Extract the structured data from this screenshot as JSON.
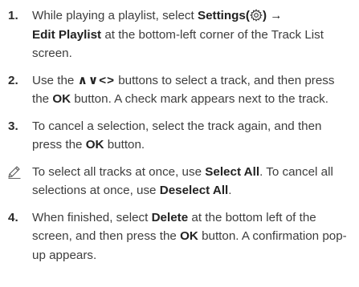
{
  "steps": [
    {
      "num": "1.",
      "parts": {
        "t1": "While playing a playlist, select ",
        "b1": "Settings(",
        "b1_close": ")",
        "arrow": " →",
        "b2": "Edit Playlist",
        "t2": " at the bottom-left corner of the Track List screen."
      }
    },
    {
      "num": "2.",
      "parts": {
        "t1": "Use the ",
        "arrows": "∧∨<>",
        "t2": " buttons to select a track, and then press the ",
        "b1": "OK",
        "t3": " button. A check mark appears next to the track."
      }
    },
    {
      "num": "3.",
      "parts": {
        "t1": "To cancel a selection, select the track again, and then press the ",
        "b1": "OK",
        "t2": " button."
      }
    },
    {
      "num": "4.",
      "parts": {
        "t1": "When finished, select ",
        "b1": "Delete",
        "t2": " at the bottom left of the screen, and then press the ",
        "b2": "OK",
        "t3": " button. A confirmation pop-up appears."
      }
    }
  ],
  "note": {
    "t1": "To select all tracks at once, use ",
    "b1": "Select All",
    "t2": ". To cancel all selections at once, use ",
    "b2": "Deselect All",
    "t3": "."
  },
  "icons": {
    "note": "pencil-note-icon",
    "settings": "gear-icon"
  }
}
